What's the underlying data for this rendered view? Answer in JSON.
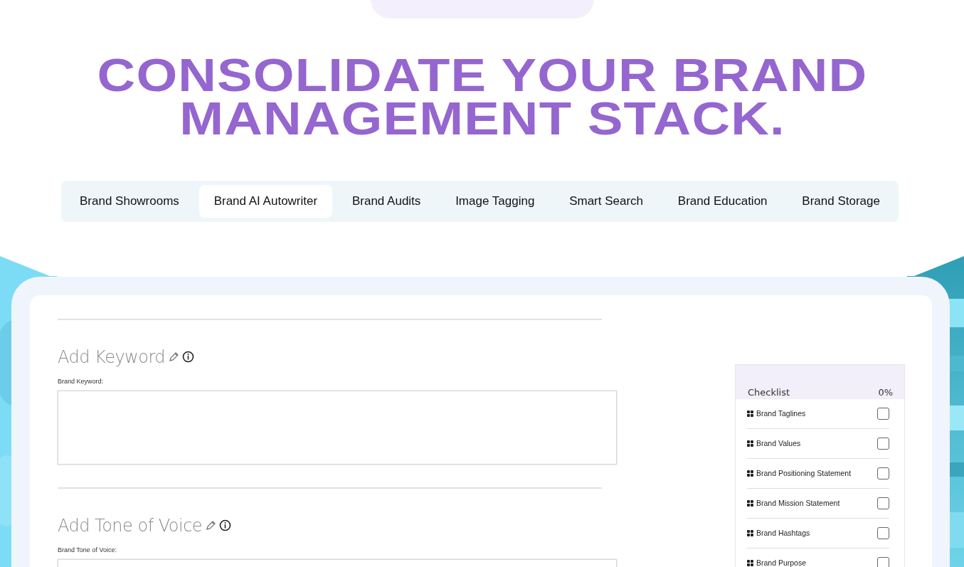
{
  "heading": "CONSOLIDATE YOUR BRAND MANAGEMENT STACK.",
  "tabs": [
    {
      "label": "Brand Showrooms",
      "selected": false
    },
    {
      "label": "Brand AI Autowriter",
      "selected": true
    },
    {
      "label": "Brand Audits",
      "selected": false
    },
    {
      "label": "Image Tagging",
      "selected": false
    },
    {
      "label": "Smart Search",
      "selected": false
    },
    {
      "label": "Brand Education",
      "selected": false
    },
    {
      "label": "Brand Storage",
      "selected": false
    }
  ],
  "form": {
    "sections": [
      {
        "title": "Add Keyword",
        "field_label": "Brand Keyword:"
      },
      {
        "title": "Add Tone of Voice",
        "field_label": "Brand Tone of Voice:"
      }
    ]
  },
  "checklist": {
    "title": "Checklist",
    "progress": "0%",
    "items": [
      {
        "label": "Brand Taglines",
        "checked": false
      },
      {
        "label": "Brand Values",
        "checked": false
      },
      {
        "label": "Brand Positioning Statement",
        "checked": false
      },
      {
        "label": "Brand Mission Statement",
        "checked": false
      },
      {
        "label": "Brand Hashtags",
        "checked": false
      },
      {
        "label": "Brand Purpose",
        "checked": false
      }
    ]
  }
}
